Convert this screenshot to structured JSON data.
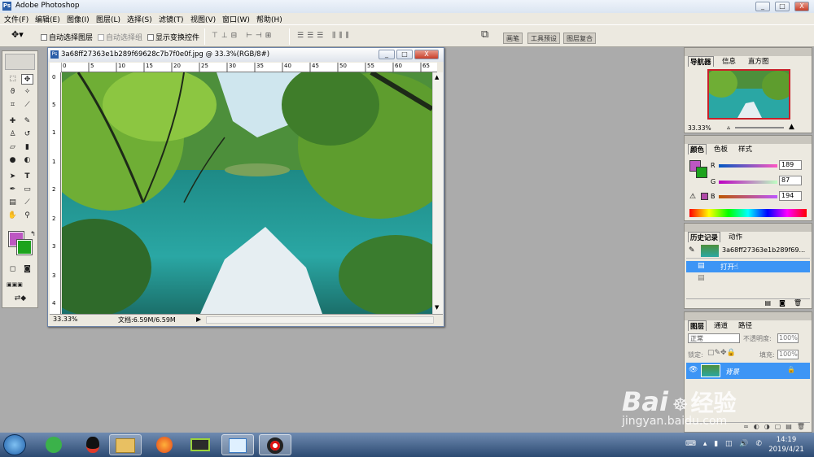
{
  "app": {
    "title": "Adobe Photoshop",
    "min": "_",
    "max": "□",
    "close": "X"
  },
  "menu": [
    "文件(F)",
    "编辑(E)",
    "图像(I)",
    "图层(L)",
    "选择(S)",
    "滤镜(T)",
    "视图(V)",
    "窗口(W)",
    "帮助(H)"
  ],
  "options": {
    "auto_select_layer": "自动选择图层",
    "auto_select_group": "自动选择组",
    "show_transform": "显示变换控件"
  },
  "palette_well_tabs": [
    "画笔",
    "工具预设",
    "图层复合"
  ],
  "document": {
    "title": "3a68ff27363e1b289f69628c7b7f0e0f.jpg @ 33.3%(RGB/8#)",
    "zoom": "33.33%",
    "doc_size": "文档:6.59M/6.59M",
    "ruler_ticks": [
      "0",
      "5",
      "10",
      "15",
      "20",
      "25",
      "30",
      "35",
      "40",
      "45",
      "50",
      "55",
      "60",
      "65"
    ],
    "ruler_v_ticks": [
      "0",
      "5",
      "1",
      "1",
      "2",
      "2",
      "3",
      "3",
      "4"
    ]
  },
  "colors": {
    "foreground": "#bd57c2",
    "background": "#1da31d",
    "accent": "#3d95f5"
  },
  "navigator": {
    "tabs": [
      "导航器",
      "信息",
      "直方图"
    ],
    "zoom": "33.33%"
  },
  "color_panel": {
    "tabs": [
      "颜色",
      "色板",
      "样式"
    ],
    "channels": [
      {
        "label": "R",
        "value": "189"
      },
      {
        "label": "G",
        "value": "87"
      },
      {
        "label": "B",
        "value": "194"
      }
    ]
  },
  "history": {
    "tabs": [
      "历史记录",
      "动作"
    ],
    "snapshot": "3a68ff27363e1b289f69...",
    "items": [
      "打开"
    ]
  },
  "layers": {
    "tabs": [
      "图层",
      "通道",
      "路径"
    ],
    "blend_mode": "正常",
    "opacity_label": "不透明度:",
    "opacity_value": "100%",
    "lock_label": "锁定:",
    "fill_label": "填充:",
    "fill_value": "100%",
    "layer_name": "背景"
  },
  "taskbar": {
    "time": "14:19",
    "date": "2019/4/21"
  },
  "watermark": {
    "brand": "Bai",
    "brand2": "经验",
    "url": "jingyan.baidu.com"
  }
}
